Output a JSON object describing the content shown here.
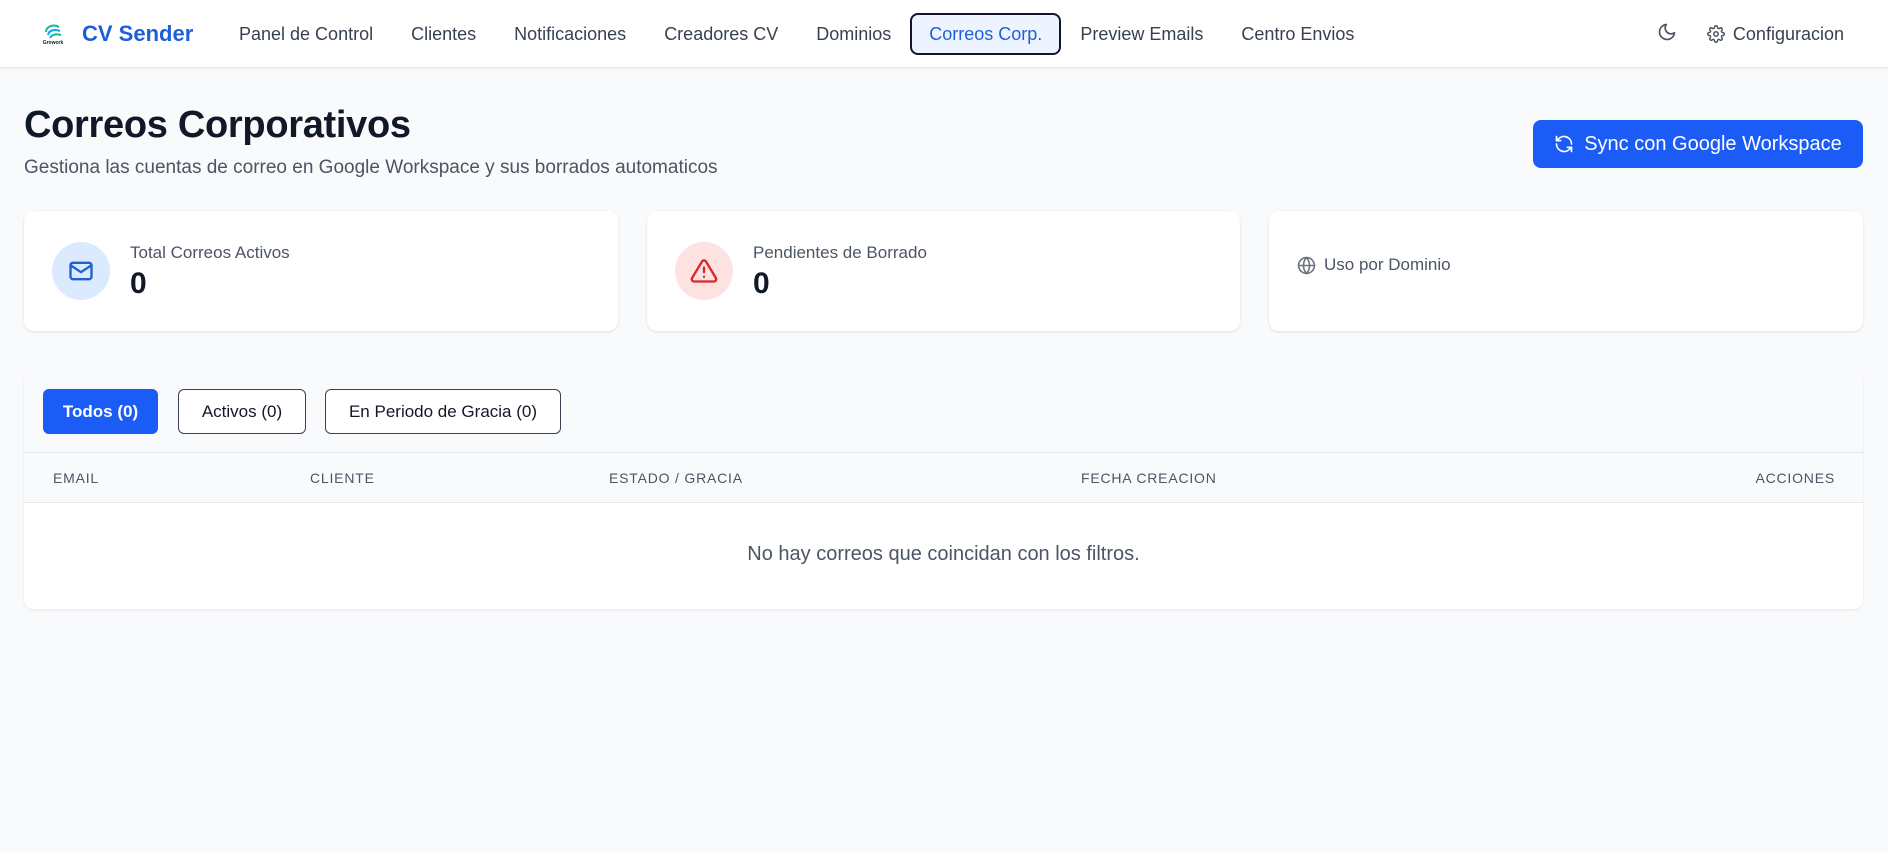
{
  "header": {
    "brand": "CV Sender",
    "logo_text": "Growork",
    "nav": [
      {
        "label": "Panel de Control",
        "active": false
      },
      {
        "label": "Clientes",
        "active": false
      },
      {
        "label": "Notificaciones",
        "active": false
      },
      {
        "label": "Creadores CV",
        "active": false
      },
      {
        "label": "Dominios",
        "active": false
      },
      {
        "label": "Correos Corp.",
        "active": true
      },
      {
        "label": "Preview Emails",
        "active": false
      },
      {
        "label": "Centro Envios",
        "active": false
      }
    ],
    "theme_icon": "moon-icon",
    "settings_label": "Configuracion",
    "settings_icon": "gear-icon"
  },
  "page": {
    "title": "Correos Corporativos",
    "subtitle": "Gestiona las cuentas de correo en Google Workspace y sus borrados automaticos",
    "sync_button": "Sync con Google Workspace",
    "sync_icon": "refresh-icon"
  },
  "stats": {
    "total_label": "Total Correos Activos",
    "total_value": "0",
    "total_icon": "mail-icon",
    "pending_label": "Pendientes de Borrado",
    "pending_value": "0",
    "pending_icon": "warning-icon",
    "domain_label": "Uso por Dominio",
    "domain_icon": "globe-icon"
  },
  "filters": [
    {
      "label": "Todos (0)",
      "active": true
    },
    {
      "label": "Activos (0)",
      "active": false
    },
    {
      "label": "En Periodo de Gracia (0)",
      "active": false
    }
  ],
  "table": {
    "columns": [
      "EMAIL",
      "CLIENTE",
      "ESTADO / GRACIA",
      "FECHA CREACION",
      "ACCIONES"
    ],
    "rows": [],
    "empty_message": "No hay correos que coincidan con los filtros."
  },
  "colors": {
    "primary": "#1a5cf5",
    "brand_text": "#1d5fd8",
    "background": "#f8fafc",
    "danger": "#dc2626"
  }
}
